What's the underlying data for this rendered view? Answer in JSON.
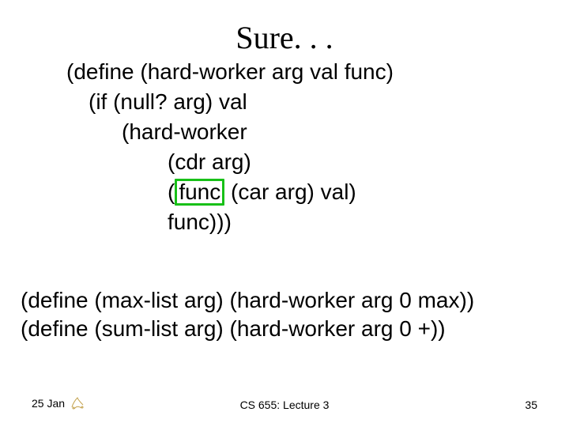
{
  "title": "Sure. . .",
  "code": {
    "l1": "(define (hard-worker arg val func)",
    "l2": "(if (null? arg) val",
    "l3": "(hard-worker",
    "l4": "(cdr arg)",
    "l5_open": "(",
    "l5_func": "func",
    "l5_rest": " (car arg) val)",
    "l6": "func)))"
  },
  "lower": {
    "l1": "(define (max-list arg) (hard-worker arg 0 max))",
    "l2": "(define (sum-list arg) (hard-worker arg 0 +))"
  },
  "footer": {
    "date": "25 Jan",
    "course": "CS 655: Lecture 3",
    "page": "35"
  }
}
